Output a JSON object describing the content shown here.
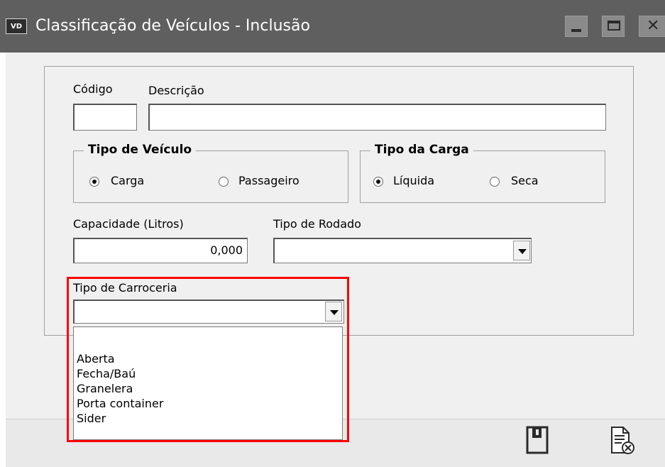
{
  "window": {
    "icon_text": "VD",
    "title": "Classificação de Veículos - Inclusão"
  },
  "form": {
    "codigo_label": "Código",
    "codigo_value": "",
    "descricao_label": "Descrição",
    "descricao_value": "",
    "tipo_veiculo": {
      "legend": "Tipo de Veículo",
      "options": [
        "Carga",
        "Passageiro"
      ],
      "selected": "Carga"
    },
    "tipo_carga": {
      "legend": "Tipo da Carga",
      "options": [
        "Líquida",
        "Seca"
      ],
      "selected": "Líquida"
    },
    "capacidade_label": "Capacidade (Litros)",
    "capacidade_value": "0,000",
    "tipo_rodado_label": "Tipo de Rodado",
    "tipo_rodado_value": "",
    "tipo_carroceria_label": "Tipo de Carroceria",
    "tipo_carroceria_value": "",
    "tipo_carroceria_options": [
      "",
      "Aberta",
      "Fecha/Baú",
      "Granelera",
      "Porta container",
      "Sider"
    ]
  },
  "highlight_color": "#ff0000",
  "footer": {
    "icons": [
      "save-icon",
      "cancel-document-icon"
    ]
  }
}
